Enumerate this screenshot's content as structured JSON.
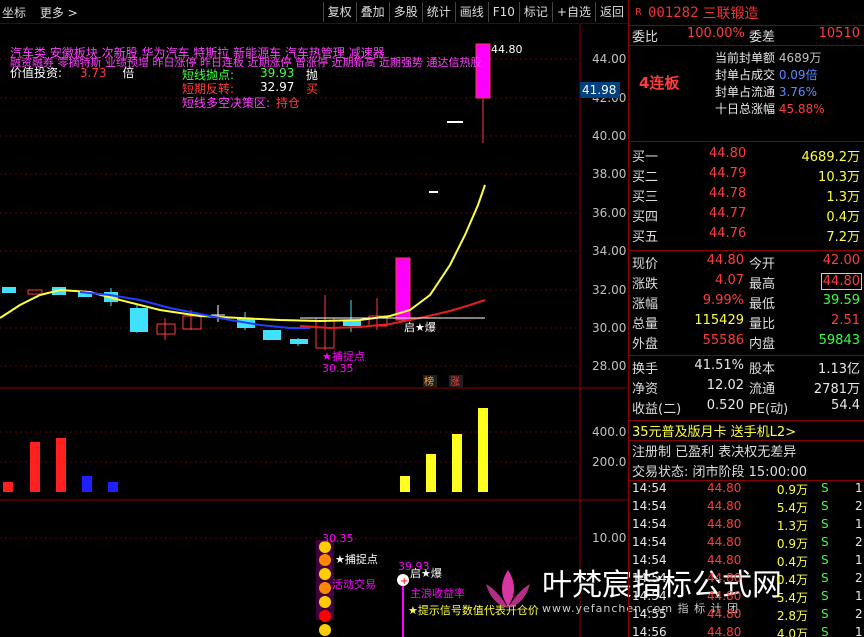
{
  "toolbar": {
    "left_items": [
      "坐标",
      "更多 >"
    ],
    "buttons": [
      "复权",
      "叠加",
      "多股",
      "统计",
      "画线",
      "F10",
      "标记",
      "+自选",
      "返回"
    ]
  },
  "main_chart": {
    "y_ticks": [
      "44.00",
      "42.00",
      "40.00",
      "38.00",
      "36.00",
      "34.00",
      "32.00",
      "30.00",
      "28.00"
    ],
    "last_price_tag": "41.98",
    "top_price_label": "44.80",
    "line1": "汽车类    安徽板块   次新股 华为汽车 特斯拉 新能源车 汽车热管理 减速器",
    "line2": "融资融券 零摘特斯 业绩预增 昨日涨停 昨日连板 近期涨停 曾涨停 近期新高 近期强势 通达信热股",
    "line3_label": "价值投资:",
    "line3_value": "3.73",
    "line3_unit": "倍",
    "short_rows": [
      {
        "label": "短线抛点:",
        "value": "39.93",
        "tag": "抛"
      },
      {
        "label": "短期反转:",
        "value": "32.97",
        "tag": "买"
      },
      {
        "label": "短线多空决策区:",
        "value": "",
        "tag": "持仓"
      }
    ],
    "capture_label": "★捕捉点",
    "capture_value": "30.35",
    "launch_label": "启★爆",
    "small_tags": [
      "榜",
      "涨"
    ]
  },
  "volume_chart": {
    "y_ticks": [
      "400.0",
      "200.0"
    ]
  },
  "indicator_chart": {
    "y_ticks": [
      "10.00"
    ],
    "value1": "30.35",
    "label_capture": "★捕捉点",
    "label_active": "活动交易",
    "value2": "39.93",
    "label_launch": "启★爆",
    "label_main": "主浪收益率",
    "label_tip": "★提示信号数值代表开仓价",
    "watermark_text": "叶梵宸指标公式网",
    "watermark_sub": "www.yefanchen.com 指 标 计 团"
  },
  "panel": {
    "r_badge": "R",
    "code": "001282",
    "name": "三联锻造",
    "weibi_label": "委比",
    "weibi_value": "100.00%",
    "weicha_label": "委差",
    "weicha_value": "10510",
    "lianban": "4连板",
    "seal_rows": [
      {
        "label": "当前封单额",
        "value": "4689万"
      },
      {
        "label": "封单占成交",
        "value": "0.09倍"
      },
      {
        "label": "封单占流通",
        "value": "3.76%"
      },
      {
        "label": "十日总涨幅",
        "value": "45.88%"
      }
    ],
    "bids": [
      {
        "label": "买一",
        "price": "44.80",
        "vol": "4689.2万"
      },
      {
        "label": "买二",
        "price": "44.79",
        "vol": "10.3万"
      },
      {
        "label": "买三",
        "price": "44.78",
        "vol": "1.3万"
      },
      {
        "label": "买四",
        "price": "44.77",
        "vol": "0.4万"
      },
      {
        "label": "买五",
        "price": "44.76",
        "vol": "7.2万"
      }
    ],
    "quote": [
      {
        "l1": "现价",
        "v1": "44.80",
        "c1": "red",
        "l2": "今开",
        "v2": "42.00",
        "c2": "red"
      },
      {
        "l1": "涨跌",
        "v1": "4.07",
        "c1": "red",
        "l2": "最高",
        "v2": "44.80",
        "c2": "red"
      },
      {
        "l1": "涨幅",
        "v1": "9.99%",
        "c1": "red",
        "l2": "最低",
        "v2": "39.59",
        "c2": "green"
      },
      {
        "l1": "总量",
        "v1": "115429",
        "c1": "yellow",
        "l2": "量比",
        "v2": "2.51",
        "c2": "red"
      },
      {
        "l1": "外盘",
        "v1": "55586",
        "c1": "red",
        "l2": "内盘",
        "v2": "59843",
        "c2": "green"
      }
    ],
    "stats": [
      {
        "l1": "换手",
        "v1": "41.51%",
        "l2": "股本",
        "v2": "1.13亿"
      },
      {
        "l1": "净资",
        "v1": "12.02",
        "l2": "流通",
        "v2": "2781万"
      },
      {
        "l1": "收益(二)",
        "v1": "0.520",
        "l2": "PE(动)",
        "v2": "54.4"
      }
    ],
    "promo": "35元普及版月卡 送手机L2>",
    "reg": "注册制 已盈利 表决权无差异",
    "status": "交易状态: 闭市阶段 15:00:00",
    "trades": [
      {
        "time": "14:54",
        "price": "44.80",
        "vol": "0.9万",
        "side": "S",
        "n": "1"
      },
      {
        "time": "14:54",
        "price": "44.80",
        "vol": "5.4万",
        "side": "S",
        "n": "2"
      },
      {
        "time": "14:54",
        "price": "44.80",
        "vol": "1.3万",
        "side": "S",
        "n": "1"
      },
      {
        "time": "14:54",
        "price": "44.80",
        "vol": "0.9万",
        "side": "S",
        "n": "2"
      },
      {
        "time": "14:54",
        "price": "44.80",
        "vol": "0.4万",
        "side": "S",
        "n": "1"
      },
      {
        "time": "14:54",
        "price": "44.80",
        "vol": "0.4万",
        "side": "S",
        "n": "2"
      },
      {
        "time": "14:54",
        "price": "44.80",
        "vol": "5.4万",
        "side": "S",
        "n": "1"
      },
      {
        "time": "14:55",
        "price": "44.80",
        "vol": "2.8万",
        "side": "S",
        "n": "2"
      },
      {
        "time": "14:56",
        "price": "44.80",
        "vol": "4.0万",
        "side": "S",
        "n": "1"
      }
    ]
  },
  "colors": {
    "up": "#ff3c3c",
    "down": "#40e0ff",
    "magenta": "#ff00ff",
    "ma_yellow": "#ffff40",
    "ma_red": "#e02020",
    "ma_blue": "#2040ff",
    "ma_white": "#ffffff"
  }
}
